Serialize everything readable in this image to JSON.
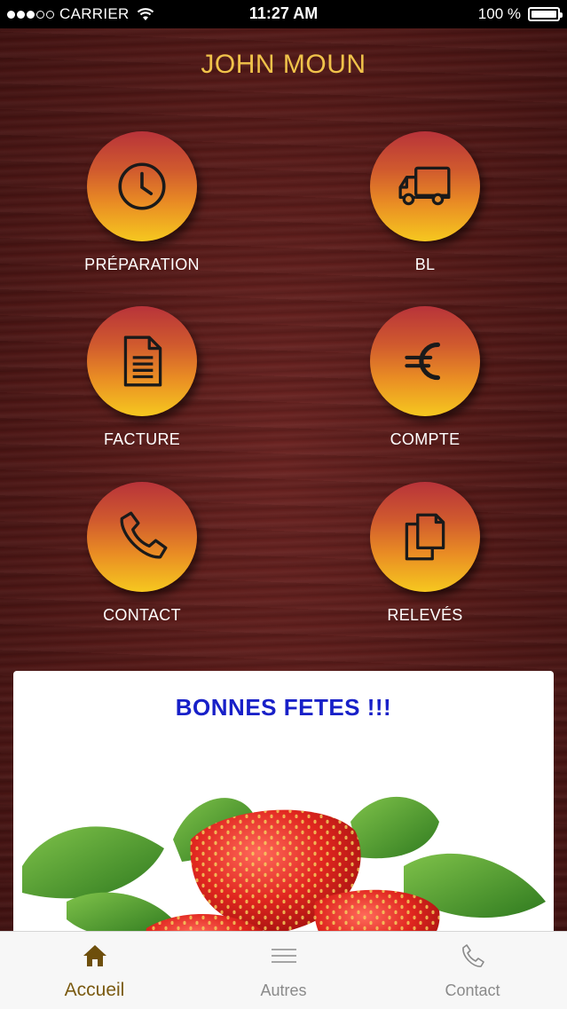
{
  "status_bar": {
    "carrier": "CARRIER",
    "time": "11:27 AM",
    "battery": "100 %"
  },
  "header": {
    "title": "JOHN MOUN"
  },
  "menu": [
    {
      "label": "PRÉPARATION",
      "icon": "clock-icon"
    },
    {
      "label": "BL",
      "icon": "truck-icon"
    },
    {
      "label": "FACTURE",
      "icon": "document-icon"
    },
    {
      "label": "COMPTE",
      "icon": "euro-icon"
    },
    {
      "label": "CONTACT",
      "icon": "phone-icon"
    },
    {
      "label": "RELEVÉS",
      "icon": "copy-icon"
    }
  ],
  "news": {
    "title": "BONNES FETES !!!"
  },
  "tab_bar": {
    "tabs": [
      {
        "label": "Accueil",
        "icon": "home-icon",
        "active": true
      },
      {
        "label": "Autres",
        "icon": "menu-lines-icon",
        "active": false
      },
      {
        "label": "Contact",
        "icon": "phone-icon",
        "active": false
      }
    ]
  },
  "colors": {
    "title": "#f0c34a",
    "circle_top": "#b8333a",
    "circle_bottom": "#f6c81f",
    "news_title": "#1820c8",
    "tab_active": "#7a5a10",
    "tab_inactive": "#8a8a8a"
  }
}
